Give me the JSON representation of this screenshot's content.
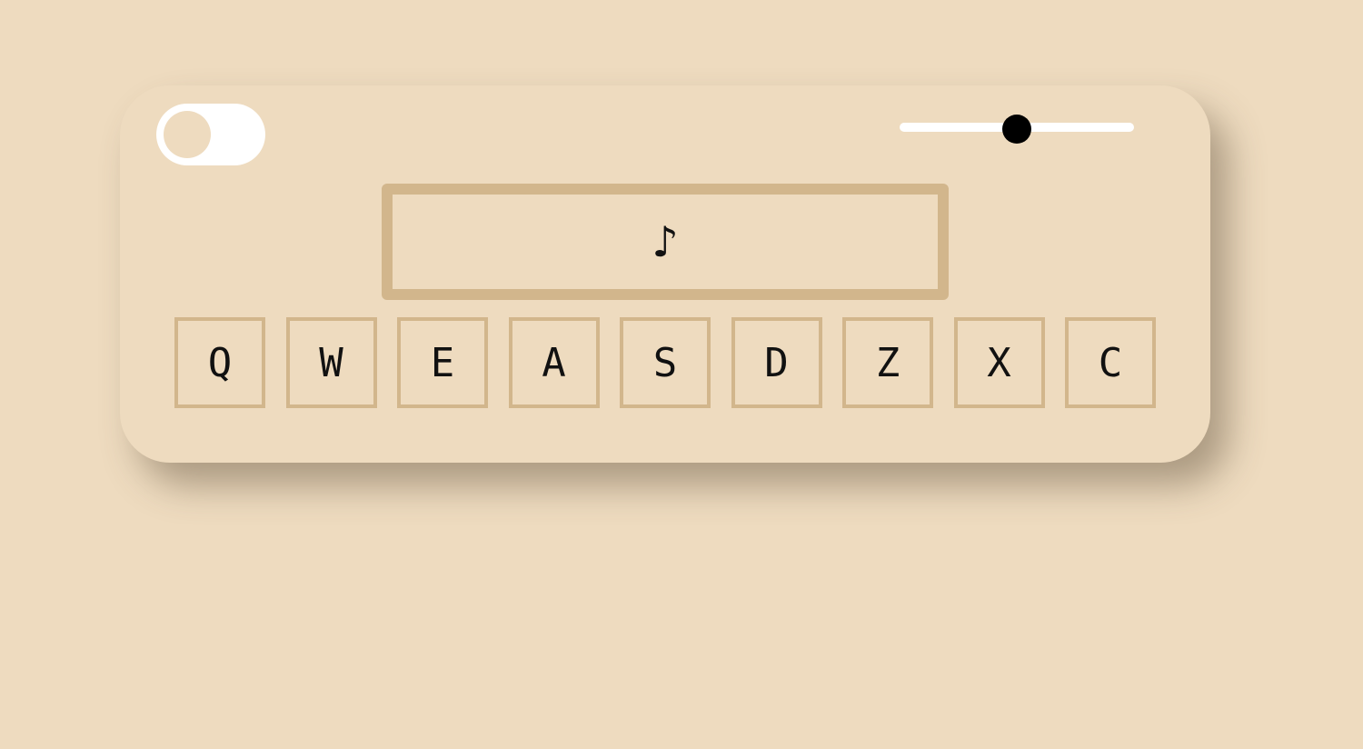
{
  "toggle": {
    "on": false
  },
  "volume": {
    "value": 0.5
  },
  "display": {
    "symbol": "♪"
  },
  "keys": [
    "Q",
    "W",
    "E",
    "A",
    "S",
    "D",
    "Z",
    "X",
    "C"
  ],
  "colors": {
    "background": "#eedbbf",
    "accent": "#d2b68c",
    "toggle_track": "#ffffff",
    "slider_thumb": "#000000",
    "text": "#111111"
  }
}
